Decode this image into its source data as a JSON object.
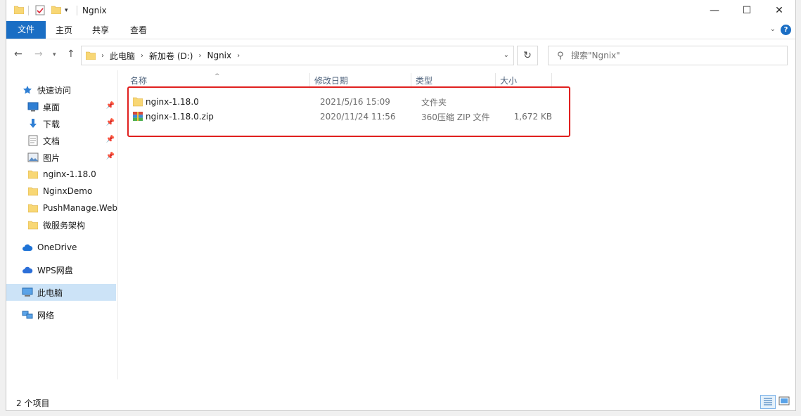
{
  "window": {
    "title": "Ngnix",
    "controls": {
      "minimize": "—",
      "maximize": "☐",
      "close": "✕"
    }
  },
  "ribbon": {
    "tabs": [
      {
        "label": "文件"
      },
      {
        "label": "主页"
      },
      {
        "label": "共享"
      },
      {
        "label": "查看"
      }
    ],
    "help": "?"
  },
  "address": {
    "breadcrumbs": [
      "此电脑",
      "新加卷 (D:)",
      "Ngnix"
    ],
    "search_placeholder": "搜索\"Ngnix\""
  },
  "nav": {
    "quick_access": "快速访问",
    "items": [
      {
        "label": "桌面",
        "icon": "desktop-icon",
        "pinned": true
      },
      {
        "label": "下载",
        "icon": "download-icon",
        "pinned": true
      },
      {
        "label": "文档",
        "icon": "documents-icon",
        "pinned": true
      },
      {
        "label": "图片",
        "icon": "pictures-icon",
        "pinned": true
      },
      {
        "label": "nginx-1.18.0",
        "icon": "folder-icon",
        "pinned": false
      },
      {
        "label": "NginxDemo",
        "icon": "folder-icon",
        "pinned": false
      },
      {
        "label": "PushManage.Web",
        "icon": "folder-icon",
        "pinned": false
      },
      {
        "label": "微服务架构",
        "icon": "folder-icon",
        "pinned": false
      }
    ],
    "onedrive": "OneDrive",
    "wps": "WPS网盘",
    "this_pc": "此电脑",
    "network": "网络"
  },
  "columns": {
    "name": "名称",
    "modified": "修改日期",
    "type": "类型",
    "size": "大小"
  },
  "files": [
    {
      "name": "nginx-1.18.0",
      "modified": "2021/5/16 15:09",
      "type": "文件夹",
      "size": "",
      "icon": "folder-icon"
    },
    {
      "name": "nginx-1.18.0.zip",
      "modified": "2020/11/24 11:56",
      "type": "360压缩 ZIP 文件",
      "size": "1,672 KB",
      "icon": "zip-archive-icon"
    }
  ],
  "status": {
    "item_count": "2 个项目"
  },
  "colors": {
    "accent": "#1a6ec4",
    "highlight_box": "#e0201f",
    "selected_nav": "#cce3f7",
    "folder": "#f8d775"
  }
}
